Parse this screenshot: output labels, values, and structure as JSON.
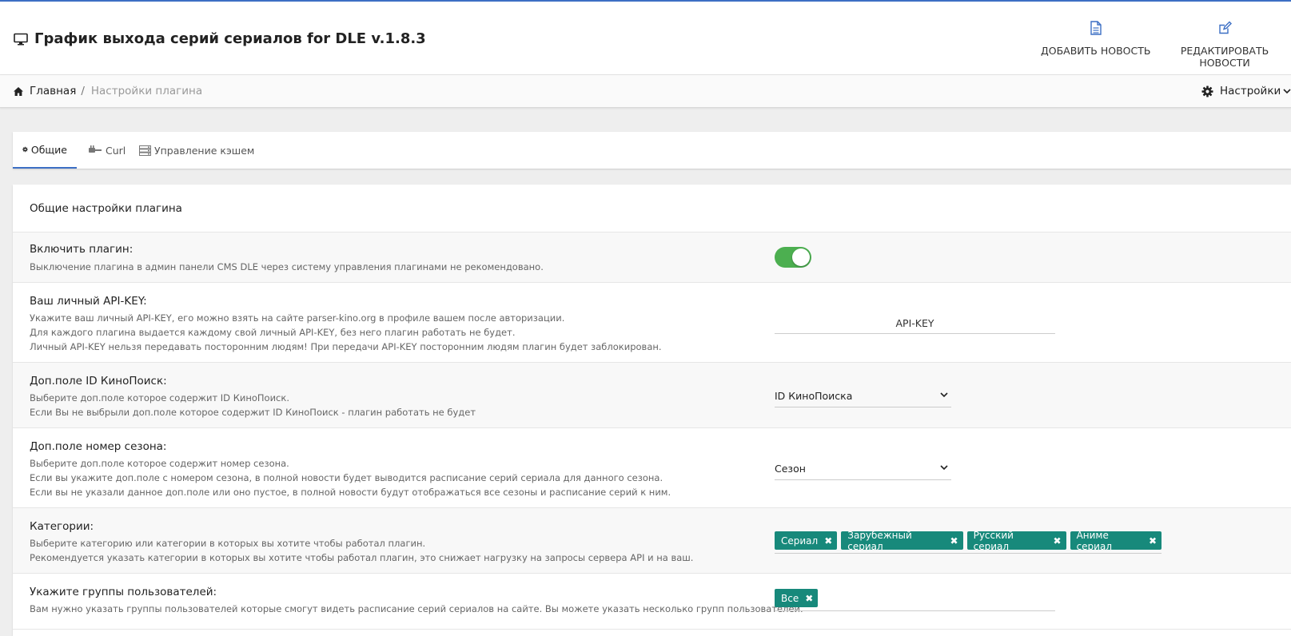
{
  "header": {
    "title": "График выхода серий сериалов for DLE v.1.8.3",
    "add_news": "ДОБАВИТЬ НОВОСТЬ",
    "edit_news": "РЕДАКТИРОВАТЬ НОВОСТИ"
  },
  "breadcrumb": {
    "home": "Главная",
    "separator": "/",
    "current": "Настройки плагина",
    "settings": "Настройки"
  },
  "tabs": [
    {
      "label": "Общие",
      "active": true
    },
    {
      "label": "Curl",
      "active": false
    },
    {
      "label": "Управление кэшем",
      "active": false
    }
  ],
  "panel": {
    "title": "Общие настройки плагина",
    "rows": [
      {
        "label": "Включить плагин:",
        "desc": [
          "Выключение плагина в админ панели CMS DLE через систему управления плагинами не рекомендовано."
        ],
        "enabled": true
      },
      {
        "label": "Ваш личный API-KEY:",
        "desc": [
          "Укажите ваш личный API-KEY, его можно взять на сайте parser-kino.org в профиле вашем после авторизации.",
          "Для каждого плагина выдается каждому свой личный API-KEY, без него плагин работать не будет.",
          "Личный API-KEY нельзя передавать посторонним людям! При передачи API-KEY посторонним людям плагин будет заблокирован."
        ],
        "placeholder": "API-KEY"
      },
      {
        "label": "Доп.поле ID КиноПоиск:",
        "desc": [
          "Выберите доп.поле которое содержит ID КиноПоиск.",
          "Если Вы не выбрыли доп.поле которое содержит ID КиноПоиск - плагин работать не будет"
        ],
        "value": "ID КиноПоиска"
      },
      {
        "label": "Доп.поле номер сезона:",
        "desc": [
          "Выберите доп.поле которое содержит номер сезона.",
          "Если вы укажите доп.поле с номером сезона, в полной новости будет выводится расписание серий сериала для данного сезона.",
          "Если вы не указали данное доп.поле или оно пустое, в полной новости будут отображаться все сезоны и расписание серий к ним."
        ],
        "value": "Сезон"
      },
      {
        "label": "Категории:",
        "desc": [
          "Выберите категорию или категории в которых вы хотите чтобы работал плагин.",
          "Рекомендуется указать категории в которых вы хотите чтобы работал плагин, это снижает нагрузку на запросы сервера API и на ваш."
        ],
        "tags": [
          "Сериал",
          "Зарубежный сериал",
          "Русский сериал",
          "Аниме сериал"
        ]
      },
      {
        "label": "Укажите группы пользователей:",
        "desc": [
          "Вам нужно указать группы пользователей которые смогут видеть расписание серий сериалов на сайте. Вы можете указать несколько групп пользователей."
        ],
        "tags": [
          "Все"
        ]
      }
    ]
  },
  "colors": {
    "accent": "#3c6fc4",
    "toggle_on": "#4caf50",
    "tag": "#17897b"
  }
}
